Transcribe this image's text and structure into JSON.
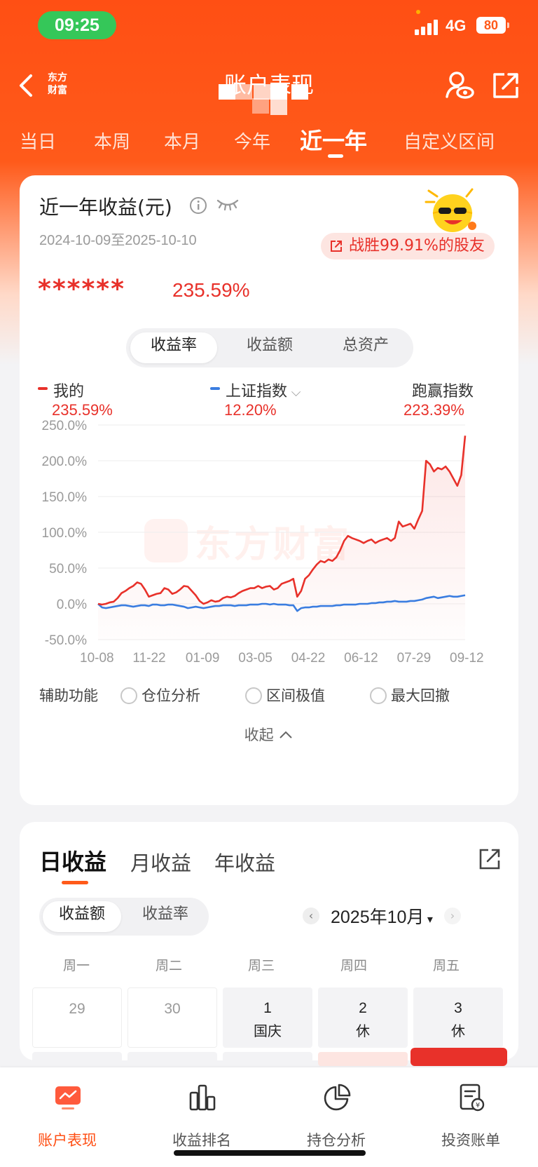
{
  "status_bar": {
    "time": "09:25",
    "network": "4G",
    "battery": "80"
  },
  "nav": {
    "title": "账户表现",
    "logo_text_line1": "东方",
    "logo_text_line2": "财富"
  },
  "tabs": [
    {
      "label": "当日"
    },
    {
      "label": "本周"
    },
    {
      "label": "本月"
    },
    {
      "label": "今年"
    },
    {
      "label": "近一年"
    },
    {
      "label": "自定义区间"
    }
  ],
  "active_tab": "近一年",
  "summary": {
    "title": "近一年收益(元)",
    "date_range": "2024-10-09至2025-10-10",
    "amount_masked": "******",
    "return_pct": "235.59%",
    "beat_text": "战胜99.91%的股友"
  },
  "metric_segment": [
    "收益率",
    "收益额",
    "总资产"
  ],
  "legend": {
    "mine": {
      "label": "我的",
      "value": "235.59%"
    },
    "index": {
      "label": "上证指数",
      "value": "12.20%"
    },
    "outperform": {
      "label": "跑赢指数",
      "value": "223.39%"
    }
  },
  "chart_data": {
    "type": "line",
    "x_ticks": [
      "10-08",
      "11-22",
      "01-09",
      "03-05",
      "04-22",
      "06-12",
      "07-29",
      "09-12"
    ],
    "y_ticks": [
      "250.0%",
      "200.0%",
      "150.0%",
      "100.0%",
      "50.0%",
      "0.0%",
      "-50.0%"
    ],
    "ylim": [
      -50,
      250
    ],
    "watermark": "东方财富",
    "series": [
      {
        "name": "我的",
        "color": "#e8312a",
        "values": [
          0,
          -1,
          0,
          2,
          3,
          8,
          15,
          18,
          22,
          25,
          30,
          28,
          20,
          10,
          12,
          14,
          15,
          22,
          20,
          14,
          16,
          20,
          25,
          24,
          18,
          12,
          4,
          0,
          2,
          5,
          3,
          4,
          8,
          10,
          9,
          11,
          15,
          18,
          20,
          22,
          22,
          25,
          22,
          24,
          25,
          20,
          22,
          28,
          30,
          32,
          35,
          10,
          18,
          35,
          40,
          48,
          55,
          60,
          58,
          62,
          60,
          65,
          75,
          88,
          95,
          92,
          90,
          88,
          85,
          88,
          90,
          85,
          88,
          90,
          92,
          88,
          92,
          115,
          108,
          110,
          112,
          105,
          118,
          130,
          200,
          195,
          185,
          190,
          188,
          192,
          185,
          175,
          165,
          180,
          235
        ]
      },
      {
        "name": "上证指数",
        "color": "#3a7de0",
        "values": [
          0,
          -5,
          -6,
          -5,
          -4,
          -3,
          -2,
          -2,
          -3,
          -4,
          -3,
          -2,
          -2,
          -3,
          -1,
          -1,
          -2,
          -2,
          -1,
          -1,
          -2,
          -3,
          -4,
          -6,
          -5,
          -4,
          -5,
          -6,
          -5,
          -4,
          -3,
          -3,
          -2,
          -2,
          -2,
          -3,
          -2,
          -2,
          -2,
          -1,
          -1,
          -1,
          0,
          0,
          -1,
          0,
          -1,
          -1,
          -1,
          -2,
          -2,
          -10,
          -6,
          -5,
          -5,
          -4,
          -4,
          -3,
          -3,
          -3,
          -3,
          -2,
          -2,
          -1,
          -1,
          -1,
          -1,
          0,
          0,
          0,
          1,
          1,
          2,
          2,
          3,
          3,
          4,
          3,
          3,
          3,
          4,
          4,
          5,
          6,
          8,
          9,
          10,
          8,
          9,
          10,
          11,
          10,
          10,
          11,
          12
        ]
      }
    ]
  },
  "aux": {
    "label": "辅助功能",
    "options": [
      "仓位分析",
      "区间极值",
      "最大回撤"
    ],
    "collapse": "收起"
  },
  "profit_tabs": [
    "日收益",
    "月收益",
    "年收益"
  ],
  "profit_segment": [
    "收益额",
    "收益率"
  ],
  "calendar": {
    "month": "2025年10月",
    "weekdays": [
      "周一",
      "周二",
      "周三",
      "周四",
      "周五"
    ],
    "cells": [
      {
        "day": "29",
        "note": ""
      },
      {
        "day": "30",
        "note": ""
      },
      {
        "day": "1",
        "note": "国庆"
      },
      {
        "day": "2",
        "note": "休"
      },
      {
        "day": "3",
        "note": "休"
      }
    ]
  },
  "bottom_nav": [
    {
      "label": "账户表现",
      "icon": "chart-screen-icon"
    },
    {
      "label": "收益排名",
      "icon": "bar-chart-icon"
    },
    {
      "label": "持仓分析",
      "icon": "pie-chart-icon"
    },
    {
      "label": "投资账单",
      "icon": "bill-icon"
    }
  ]
}
